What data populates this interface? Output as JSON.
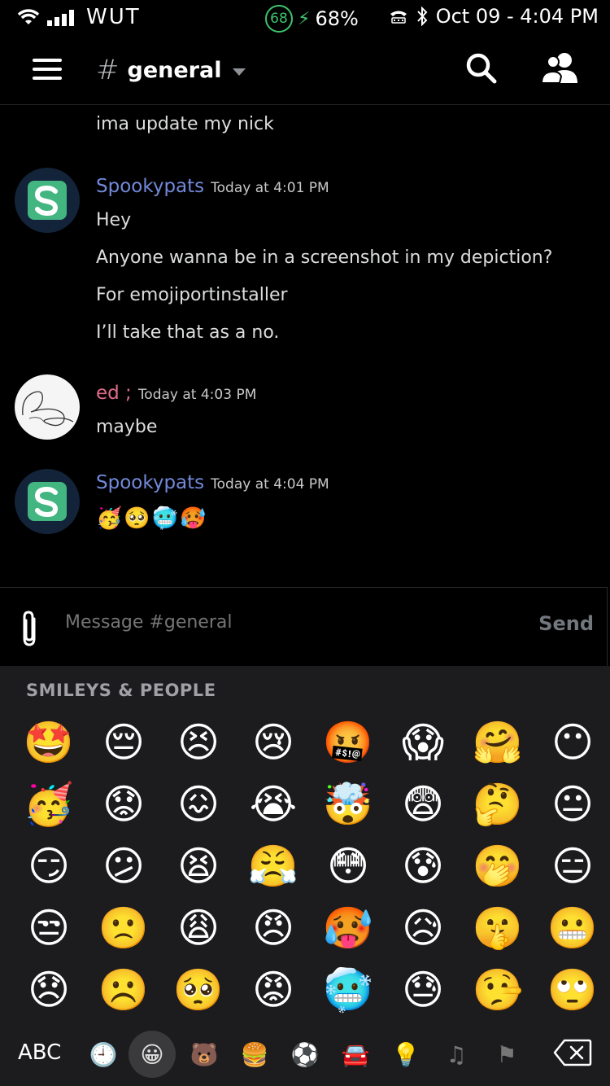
{
  "status_bar": {
    "carrier": "WUT",
    "battery_percent_circle": "68",
    "battery_text": "68%",
    "datetime": "Oct 09 - 4:04 PM"
  },
  "header": {
    "hash": "#",
    "channel_name": "general"
  },
  "messages": {
    "prev_line": "ima update my nick",
    "group1": {
      "author": "Spookypats",
      "timestamp": "Today at 4:01 PM",
      "lines": [
        "Hey",
        "Anyone wanna be in a screenshot in my depiction?",
        "For emojiportinstaller",
        "I’ll take that as a no."
      ]
    },
    "group2": {
      "author": "ed ;",
      "timestamp": "Today at 4:03 PM",
      "lines": [
        "maybe"
      ]
    },
    "group3": {
      "author": "Spookypats",
      "timestamp": "Today at 4:04 PM",
      "emojis": [
        "🥳",
        "🥺",
        "🥶",
        "🥵"
      ]
    }
  },
  "composer": {
    "placeholder": "Message #general",
    "send_label": "Send"
  },
  "keyboard": {
    "section_title": "SMILEYS & PEOPLE",
    "rows": [
      [
        "🤩",
        "😔",
        "😣",
        "😢",
        "🤬",
        "😱",
        "🤗",
        "😶"
      ],
      [
        "🥳",
        "😟",
        "😖",
        "😭",
        "🤯",
        "😨",
        "🤔",
        "😐"
      ],
      [
        "😏",
        "😕",
        "😫",
        "😤",
        "😳",
        "😰",
        "🤭",
        "😑"
      ],
      [
        "😒",
        "🙁",
        "😩",
        "😠",
        "🥵",
        "😥",
        "🤫",
        "😬"
      ],
      [
        "😞",
        "☹️",
        "🥺",
        "😡",
        "🥶",
        "😓",
        "🤥",
        "🙄"
      ]
    ],
    "abc_label": "ABC",
    "categories": [
      "clock-icon",
      "smiley-icon",
      "bear-icon",
      "food-icon",
      "soccer-icon",
      "car-icon",
      "bulb-icon",
      "symbols-icon",
      "flag-icon"
    ],
    "category_glyphs": [
      "🕘",
      "😀",
      "🐻",
      "🍔",
      "⚽",
      "🚘",
      "💡",
      "♫",
      "⚑"
    ],
    "active_category": "smiley-icon"
  }
}
